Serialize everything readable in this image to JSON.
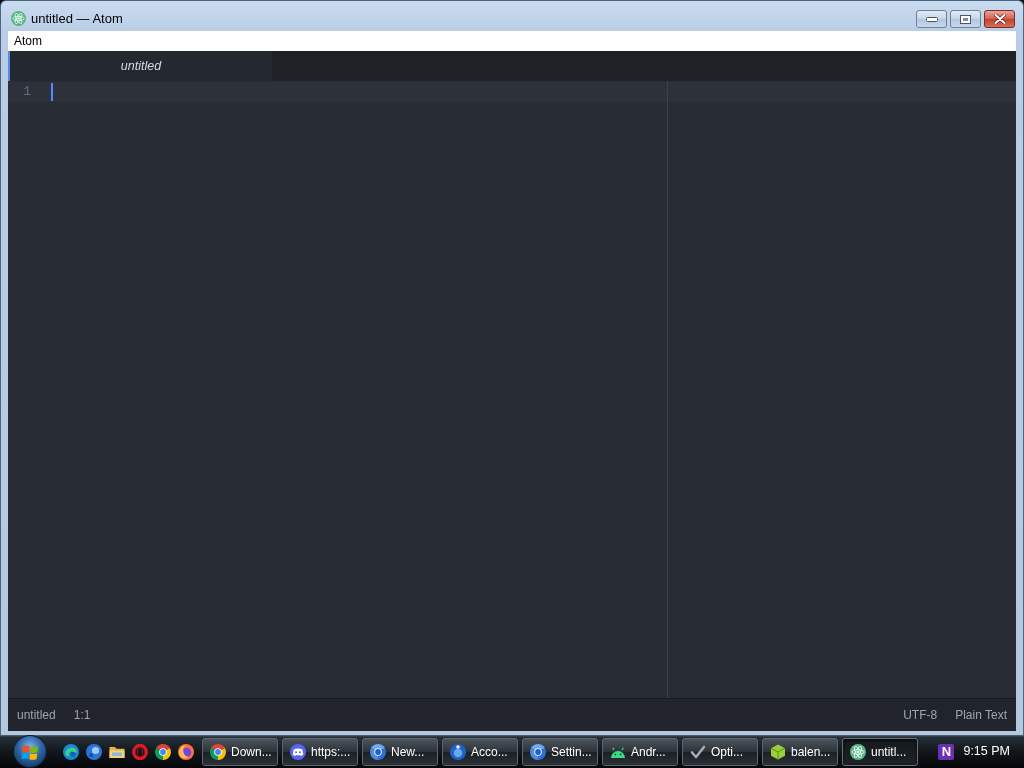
{
  "window": {
    "title": "untitled — Atom"
  },
  "menu_bar": {
    "items": [
      "Atom"
    ]
  },
  "tabs": [
    {
      "label": "untitled",
      "selected": true
    }
  ],
  "editor": {
    "lines": [
      {
        "number": "1",
        "current": true
      }
    ]
  },
  "status_bar": {
    "left": [
      "untitled",
      "1:1"
    ],
    "right": [
      "UTF-8",
      "Plain Text"
    ]
  },
  "taskbar": {
    "buttons": [
      {
        "label": "Down...",
        "selected": false
      },
      {
        "label": "https:...",
        "selected": false
      },
      {
        "label": "New...",
        "selected": false
      },
      {
        "label": "Acco...",
        "selected": false
      },
      {
        "label": "Settin...",
        "selected": false
      },
      {
        "label": "Andr...",
        "selected": false
      },
      {
        "label": "Opti...",
        "selected": false
      },
      {
        "label": "balen...",
        "selected": false
      },
      {
        "label": "untitl...",
        "selected": true
      }
    ],
    "tray_icons": [
      "N"
    ],
    "clock": "9:15 PM"
  }
}
